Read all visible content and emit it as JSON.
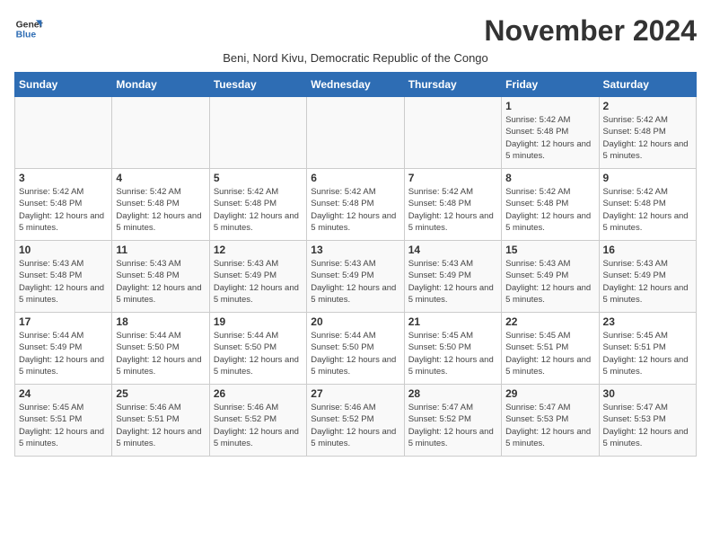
{
  "logo": {
    "line1": "General",
    "line2": "Blue"
  },
  "title": "November 2024",
  "subtitle": "Beni, Nord Kivu, Democratic Republic of the Congo",
  "days_header": [
    "Sunday",
    "Monday",
    "Tuesday",
    "Wednesday",
    "Thursday",
    "Friday",
    "Saturday"
  ],
  "weeks": [
    [
      {
        "day": "",
        "info": ""
      },
      {
        "day": "",
        "info": ""
      },
      {
        "day": "",
        "info": ""
      },
      {
        "day": "",
        "info": ""
      },
      {
        "day": "",
        "info": ""
      },
      {
        "day": "1",
        "info": "Sunrise: 5:42 AM\nSunset: 5:48 PM\nDaylight: 12 hours and 5 minutes."
      },
      {
        "day": "2",
        "info": "Sunrise: 5:42 AM\nSunset: 5:48 PM\nDaylight: 12 hours and 5 minutes."
      }
    ],
    [
      {
        "day": "3",
        "info": "Sunrise: 5:42 AM\nSunset: 5:48 PM\nDaylight: 12 hours and 5 minutes."
      },
      {
        "day": "4",
        "info": "Sunrise: 5:42 AM\nSunset: 5:48 PM\nDaylight: 12 hours and 5 minutes."
      },
      {
        "day": "5",
        "info": "Sunrise: 5:42 AM\nSunset: 5:48 PM\nDaylight: 12 hours and 5 minutes."
      },
      {
        "day": "6",
        "info": "Sunrise: 5:42 AM\nSunset: 5:48 PM\nDaylight: 12 hours and 5 minutes."
      },
      {
        "day": "7",
        "info": "Sunrise: 5:42 AM\nSunset: 5:48 PM\nDaylight: 12 hours and 5 minutes."
      },
      {
        "day": "8",
        "info": "Sunrise: 5:42 AM\nSunset: 5:48 PM\nDaylight: 12 hours and 5 minutes."
      },
      {
        "day": "9",
        "info": "Sunrise: 5:42 AM\nSunset: 5:48 PM\nDaylight: 12 hours and 5 minutes."
      }
    ],
    [
      {
        "day": "10",
        "info": "Sunrise: 5:43 AM\nSunset: 5:48 PM\nDaylight: 12 hours and 5 minutes."
      },
      {
        "day": "11",
        "info": "Sunrise: 5:43 AM\nSunset: 5:48 PM\nDaylight: 12 hours and 5 minutes."
      },
      {
        "day": "12",
        "info": "Sunrise: 5:43 AM\nSunset: 5:49 PM\nDaylight: 12 hours and 5 minutes."
      },
      {
        "day": "13",
        "info": "Sunrise: 5:43 AM\nSunset: 5:49 PM\nDaylight: 12 hours and 5 minutes."
      },
      {
        "day": "14",
        "info": "Sunrise: 5:43 AM\nSunset: 5:49 PM\nDaylight: 12 hours and 5 minutes."
      },
      {
        "day": "15",
        "info": "Sunrise: 5:43 AM\nSunset: 5:49 PM\nDaylight: 12 hours and 5 minutes."
      },
      {
        "day": "16",
        "info": "Sunrise: 5:43 AM\nSunset: 5:49 PM\nDaylight: 12 hours and 5 minutes."
      }
    ],
    [
      {
        "day": "17",
        "info": "Sunrise: 5:44 AM\nSunset: 5:49 PM\nDaylight: 12 hours and 5 minutes."
      },
      {
        "day": "18",
        "info": "Sunrise: 5:44 AM\nSunset: 5:50 PM\nDaylight: 12 hours and 5 minutes."
      },
      {
        "day": "19",
        "info": "Sunrise: 5:44 AM\nSunset: 5:50 PM\nDaylight: 12 hours and 5 minutes."
      },
      {
        "day": "20",
        "info": "Sunrise: 5:44 AM\nSunset: 5:50 PM\nDaylight: 12 hours and 5 minutes."
      },
      {
        "day": "21",
        "info": "Sunrise: 5:45 AM\nSunset: 5:50 PM\nDaylight: 12 hours and 5 minutes."
      },
      {
        "day": "22",
        "info": "Sunrise: 5:45 AM\nSunset: 5:51 PM\nDaylight: 12 hours and 5 minutes."
      },
      {
        "day": "23",
        "info": "Sunrise: 5:45 AM\nSunset: 5:51 PM\nDaylight: 12 hours and 5 minutes."
      }
    ],
    [
      {
        "day": "24",
        "info": "Sunrise: 5:45 AM\nSunset: 5:51 PM\nDaylight: 12 hours and 5 minutes."
      },
      {
        "day": "25",
        "info": "Sunrise: 5:46 AM\nSunset: 5:51 PM\nDaylight: 12 hours and 5 minutes."
      },
      {
        "day": "26",
        "info": "Sunrise: 5:46 AM\nSunset: 5:52 PM\nDaylight: 12 hours and 5 minutes."
      },
      {
        "day": "27",
        "info": "Sunrise: 5:46 AM\nSunset: 5:52 PM\nDaylight: 12 hours and 5 minutes."
      },
      {
        "day": "28",
        "info": "Sunrise: 5:47 AM\nSunset: 5:52 PM\nDaylight: 12 hours and 5 minutes."
      },
      {
        "day": "29",
        "info": "Sunrise: 5:47 AM\nSunset: 5:53 PM\nDaylight: 12 hours and 5 minutes."
      },
      {
        "day": "30",
        "info": "Sunrise: 5:47 AM\nSunset: 5:53 PM\nDaylight: 12 hours and 5 minutes."
      }
    ]
  ]
}
